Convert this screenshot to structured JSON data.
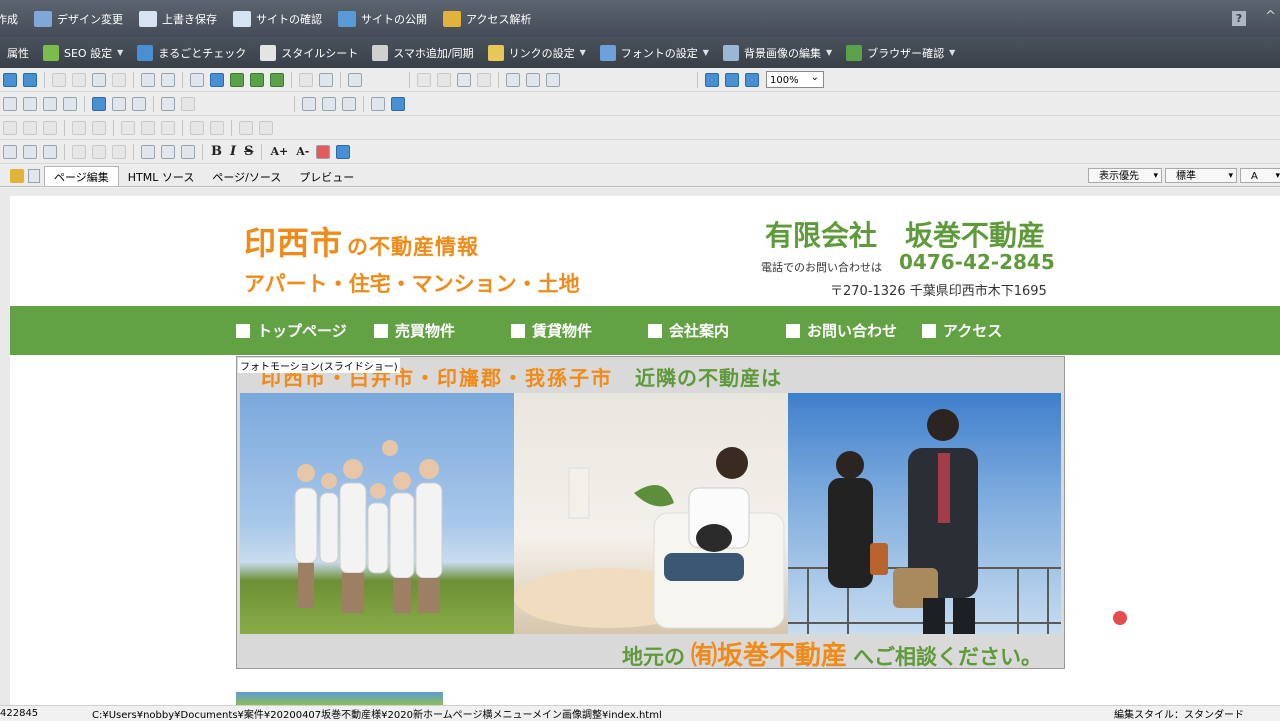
{
  "menubar": {
    "items": [
      {
        "label": "作成",
        "icon": "create-icon",
        "color": "#7fa7d8"
      },
      {
        "label": "デザイン変更",
        "icon": "design-icon",
        "color": "#7fa7d8"
      },
      {
        "label": "上書き保存",
        "icon": "save-icon",
        "color": "#d6e3f2"
      },
      {
        "label": "サイトの確認",
        "icon": "site-check-icon",
        "color": "#d6e3f2"
      },
      {
        "label": "サイトの公開",
        "icon": "globe-icon",
        "color": "#5b9bd5"
      },
      {
        "label": "アクセス解析",
        "icon": "analytics-icon",
        "color": "#e2b33a"
      }
    ],
    "help": "?",
    "caret": "^"
  },
  "menubar2": {
    "items": [
      {
        "label": "属性",
        "icon": "attribute-icon",
        "color": "#c8c8c8",
        "dropdown": false
      },
      {
        "label": "SEO 設定",
        "icon": "seo-icon",
        "color": "#7dbb4e",
        "dropdown": true
      },
      {
        "label": "まるごとチェック",
        "icon": "check-icon",
        "color": "#4a8fd1",
        "dropdown": false
      },
      {
        "label": "スタイルシート",
        "icon": "stylesheet-icon",
        "color": "#e4e4e4",
        "dropdown": false
      },
      {
        "label": "スマホ追加/同期",
        "icon": "smartphone-icon",
        "color": "#d0d0d0",
        "dropdown": false
      },
      {
        "label": "リンクの設定",
        "icon": "link-icon",
        "color": "#e8c75a",
        "dropdown": true
      },
      {
        "label": "フォントの設定",
        "icon": "font-icon",
        "color": "#6fa0d8",
        "dropdown": true
      },
      {
        "label": "背景画像の編集",
        "icon": "background-image-icon",
        "color": "#9cb6d6",
        "dropdown": true
      },
      {
        "label": "ブラウザー確認",
        "icon": "browser-icon",
        "color": "#5aa14a",
        "dropdown": true
      }
    ]
  },
  "toolbar": {
    "zoom": "100%"
  },
  "tabs": [
    {
      "label": "ページ編集",
      "active": true
    },
    {
      "label": "HTML ソース",
      "active": false
    },
    {
      "label": "ページ/ソース",
      "active": false
    },
    {
      "label": "プレビュー",
      "active": false
    }
  ],
  "right_selects": {
    "display_priority": "表示優先",
    "standard": "標準",
    "third": "A"
  },
  "site": {
    "title_main": "印西市",
    "title_sub": "の不動産情報",
    "title2": "アパート・住宅・マンション・土地",
    "company": "有限会社　坂巻不動産",
    "tel_label": "電話でのお問い合わせは",
    "tel": "0476-42-2845",
    "address": "〒270-1326 千葉県印西市木下1695",
    "nav": [
      "トップページ",
      "売買物件",
      "賃貸物件",
      "会社案内",
      "お問い合わせ",
      "アクセス"
    ],
    "slideshow_label": "フォトモーション(スライドショー)",
    "slide_head_orange": "印西市・白井市・印旛郡・我孫子市",
    "slide_head_green": "近隣の不動産は",
    "slide_foot_pre": "地元の",
    "slide_foot_company": "㈲坂巻不動産",
    "slide_foot_post": "へご相談ください。",
    "colors": {
      "orange": "#f08a18",
      "green": "#62a244"
    }
  },
  "status": {
    "left": "422845",
    "path": "C:¥Users¥nobby¥Documents¥案件¥20200407坂巻不動産様¥2020新ホームページ横メニューメイン画像調整¥index.html",
    "edit_style": "編集スタイル：スタンダード"
  }
}
